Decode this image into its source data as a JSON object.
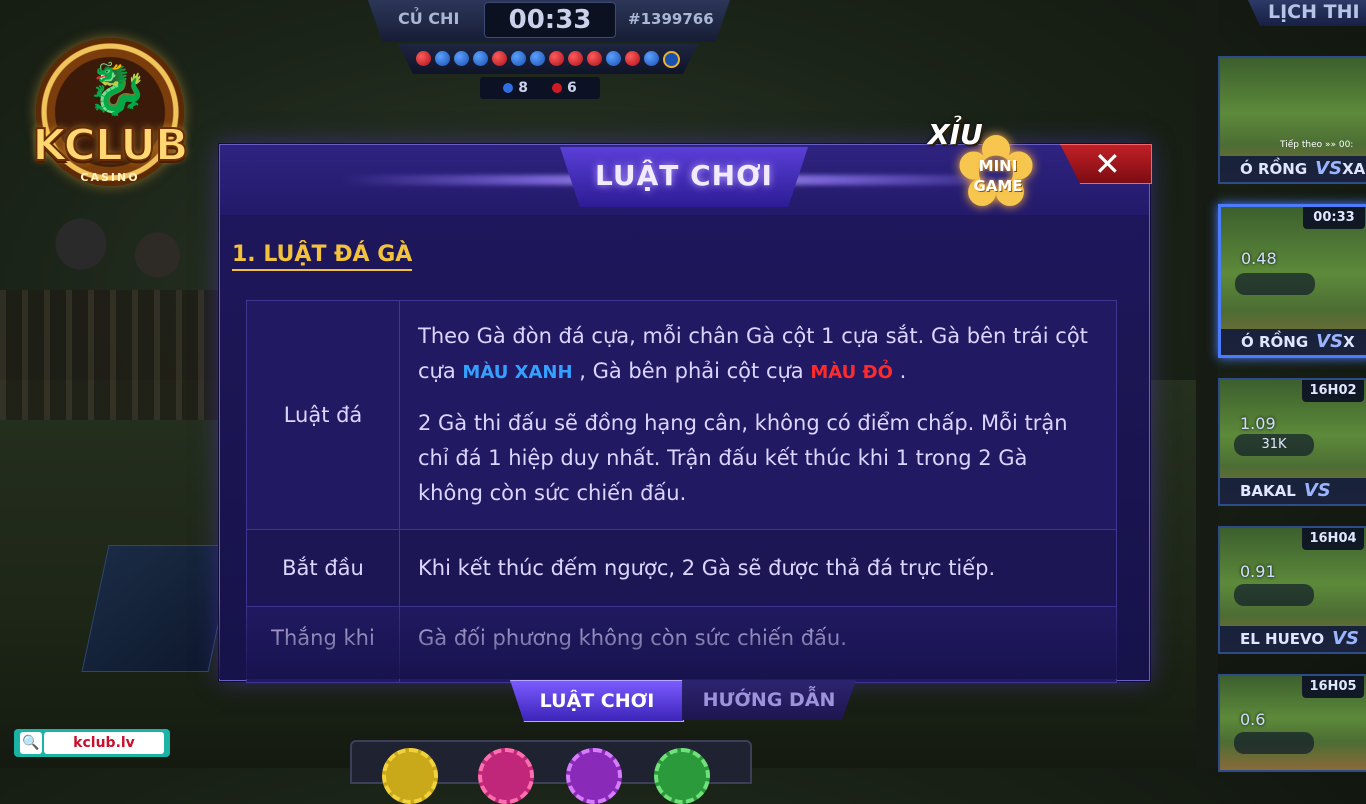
{
  "top_match": {
    "location": "CỦ CHI",
    "timer": "00:33",
    "match_id": "#1399766",
    "history": [
      "red",
      "blue",
      "blue",
      "blue",
      "red",
      "blue",
      "blue",
      "red",
      "red",
      "red",
      "blue",
      "red",
      "blue",
      "blue"
    ],
    "blue_count": "8",
    "red_count": "6"
  },
  "brand": {
    "logo_text": "KCLUB",
    "logo_sub": "CASINO",
    "site": "kclub.lv"
  },
  "modal": {
    "title": "LUẬT CHƠI",
    "section_title": "1. LUẬT ĐÁ GÀ",
    "rows": [
      {
        "label": "Luật đá",
        "p1_a": "Theo Gà đòn đá cựa, mỗi chân Gà cột 1 cựa sắt. Gà bên trái cột cựa",
        "p1_blue": "MÀU XANH",
        "p1_b": ", Gà bên phải cột cựa",
        "p1_red": "MÀU ĐỎ",
        "p1_c": ".",
        "p2": "2 Gà thi đấu sẽ đồng hạng cân, không có điểm chấp. Mỗi trận chỉ đá 1 hiệp duy nhất. Trận đấu kết thúc khi 1 trong 2 Gà không còn sức chiến đấu."
      },
      {
        "label": "Bắt đầu",
        "text": "Khi kết thúc đếm ngược, 2 Gà sẽ được thả đá trực tiếp."
      },
      {
        "label": "Thắng khi",
        "text": "Gà đối phương không còn sức chiến đấu."
      }
    ],
    "tabs": {
      "rules": "LUẬT CHƠI",
      "guide": "HƯỚNG DẪN"
    }
  },
  "minigame": {
    "xiu": "XỈU",
    "line1": "MINI",
    "line2": "GAME"
  },
  "schedule": {
    "title": "LỊCH THI Đ",
    "cards": [
      {
        "name": "Ó RỒNG",
        "vs": "VS",
        "extra": "XA",
        "time": "",
        "odds": "",
        "sub": "Tiếp theo »» 00:"
      },
      {
        "name": "Ó RỒNG",
        "vs": "VS",
        "extra": "X",
        "time": "00:33",
        "odds": "0.48",
        "sub": ""
      },
      {
        "name": "BAKAL",
        "vs": "VS",
        "extra": "",
        "time": "16H02",
        "odds": "1.09",
        "sub": "31K"
      },
      {
        "name": "EL HUEVO",
        "vs": "VS",
        "extra": "",
        "time": "16H04",
        "odds": "0.91",
        "sub": ""
      },
      {
        "name": "",
        "vs": "",
        "extra": "",
        "time": "16H05",
        "odds": "0.6",
        "sub": ""
      }
    ]
  },
  "colors": {
    "blue_spur": "#35a0ff",
    "red_spur": "#ff2a2a",
    "label_gold": "#e8b977",
    "section_gold": "#f2c23b",
    "modal_bg": "#1f1760"
  }
}
